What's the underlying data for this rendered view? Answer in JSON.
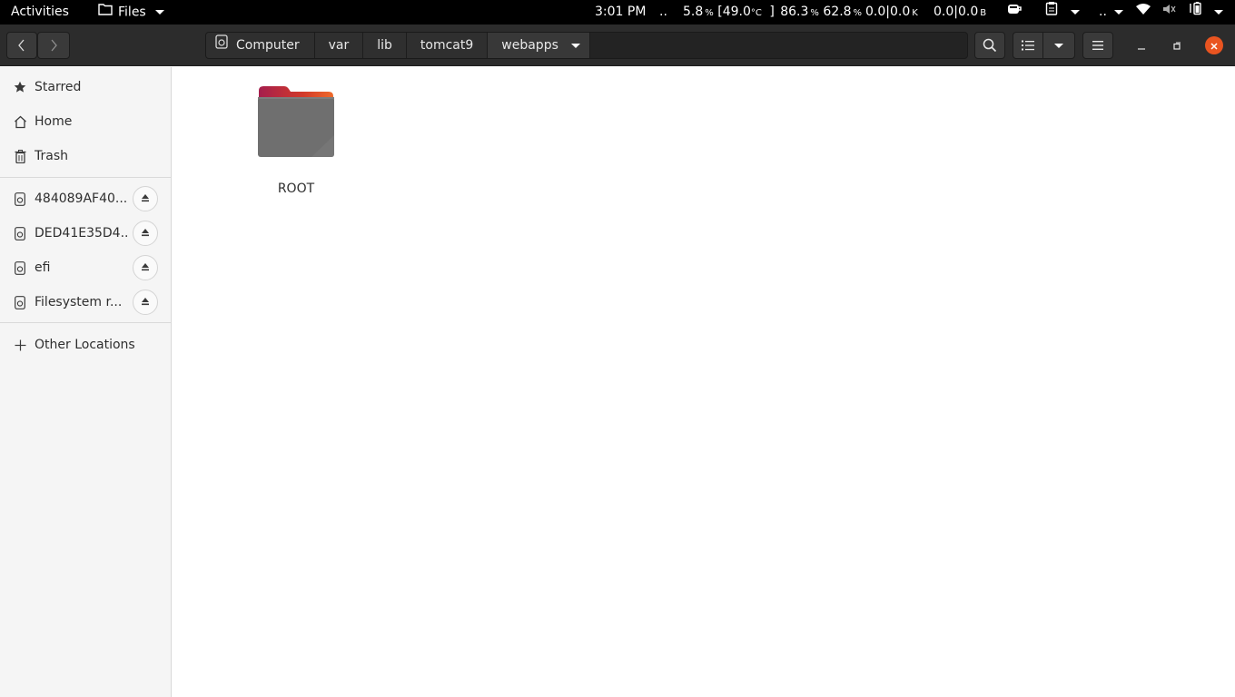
{
  "topbar": {
    "activities": "Activities",
    "app_menu": "Files",
    "clock": "3:01 PM",
    "dots1": "..",
    "cpu_value": "5.8",
    "cpu_unit": "%",
    "temp_open": "[49.0",
    "temp_unit": "°C",
    "temp_close": "]",
    "mem_value": "86.3",
    "mem_unit": "%",
    "swap_value": "62.8",
    "swap_unit": "%",
    "net_value": "0.0|0.0",
    "net_unit": "K",
    "disk_value": "0.0|0.0",
    "disk_unit": "B",
    "dots2": ".."
  },
  "headerbar": {
    "path": [
      "Computer",
      "var",
      "lib",
      "tomcat9",
      "webapps"
    ]
  },
  "sidebar": {
    "places": [
      {
        "label": "Starred",
        "icon": "star-icon"
      },
      {
        "label": "Home",
        "icon": "home-icon"
      },
      {
        "label": "Trash",
        "icon": "trash-icon"
      }
    ],
    "devices": [
      {
        "label": "484089AF40...",
        "icon": "drive-icon"
      },
      {
        "label": "DED41E35D4...",
        "icon": "drive-icon"
      },
      {
        "label": "efi",
        "icon": "drive-icon"
      },
      {
        "label": "Filesystem r...",
        "icon": "drive-icon"
      }
    ],
    "other_locations": "Other Locations"
  },
  "content": {
    "files": [
      {
        "name": "ROOT",
        "type": "folder"
      }
    ]
  },
  "colors": {
    "close_button": "#e95420",
    "folder_body": "#6f6f6f",
    "folder_tab": "#c7162b"
  }
}
